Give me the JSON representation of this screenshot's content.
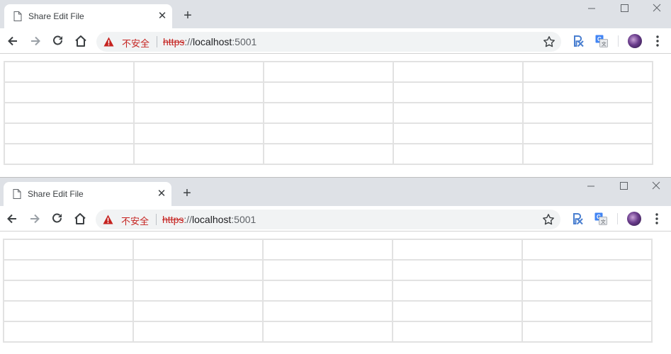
{
  "windows": [
    {
      "tab": {
        "title": "Share Edit File"
      },
      "address": {
        "not_secure_label": "不安全",
        "scheme": "https",
        "separator": "://",
        "host": "localhost",
        "port": ":5001"
      },
      "table": {
        "rows": 5,
        "cols": 5
      }
    },
    {
      "tab": {
        "title": "Share Edit File"
      },
      "address": {
        "not_secure_label": "不安全",
        "scheme": "https",
        "separator": "://",
        "host": "localhost",
        "port": ":5001"
      },
      "table": {
        "rows": 5,
        "cols": 5
      }
    }
  ],
  "icons": {
    "page": "page-icon",
    "close": "close-icon",
    "new_tab": "plus-icon",
    "minimize": "minimize-icon",
    "maximize": "maximize-icon",
    "window_close": "window-close-icon",
    "back": "back-arrow-icon",
    "forward": "forward-arrow-icon",
    "reload": "reload-icon",
    "home": "home-icon",
    "warning": "warning-icon",
    "bookmark": "star-icon",
    "ext1": "rx-extension-icon",
    "ext2": "google-translate-icon",
    "profile": "avatar",
    "menu": "kebab-menu-icon"
  },
  "colors": {
    "titlebar": "#dee1e6",
    "omnibox": "#f1f3f4",
    "not_secure": "#c5221f",
    "cell_border": "#e2e2e2"
  }
}
